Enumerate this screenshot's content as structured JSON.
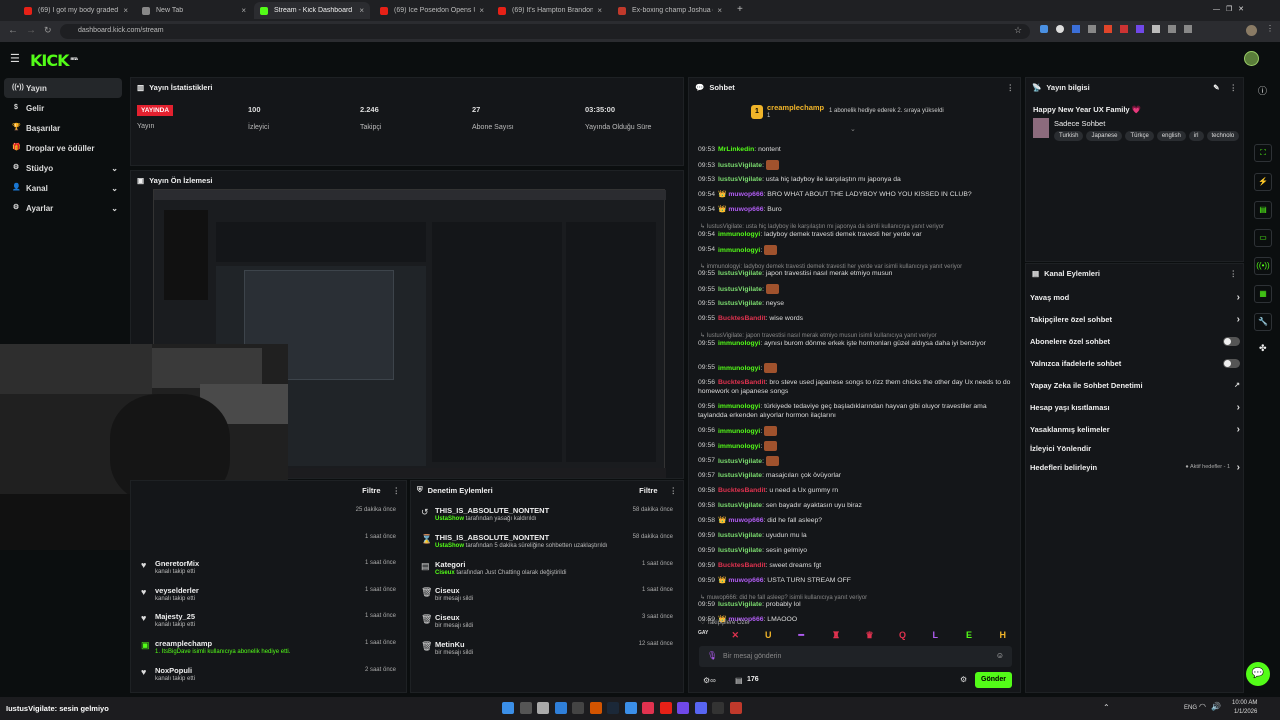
{
  "browser": {
    "tabs": [
      {
        "label": "(69) I got my body graded in J…",
        "color": "#e62117"
      },
      {
        "label": "New Tab",
        "color": "#888888"
      },
      {
        "label": "Stream - Kick Dashboard",
        "color": "#53fc18"
      },
      {
        "label": "(69) Ice Poseidon Opens Up o…",
        "color": "#e62117"
      },
      {
        "label": "(69) It's Hampton Brandon in J…",
        "color": "#e62117"
      },
      {
        "label": "Ex-boxing champ Joshua ditch…",
        "color": "#c0392b"
      }
    ],
    "url": "dashboard.kick.com/stream"
  },
  "site": {
    "logo": "KICK",
    "logo_badge": "BETA"
  },
  "sidenav": [
    {
      "label": "Yayın",
      "icon": "broadcast-icon"
    },
    {
      "label": "Gelir",
      "icon": "dollar-icon"
    },
    {
      "label": "Başarılar",
      "icon": "trophy-icon"
    },
    {
      "label": "Droplar ve ödüller",
      "icon": "gift-icon"
    },
    {
      "label": "Stüdyo",
      "icon": "gear-icon",
      "chev": "⌄"
    },
    {
      "label": "Kanal",
      "icon": "user-icon",
      "chev": "⌄"
    },
    {
      "label": "Ayarlar",
      "icon": "settings-icon",
      "chev": "⌄"
    }
  ],
  "stats": {
    "title": "Yayın İstatistikleri",
    "live_badge": "YAYINDA",
    "live_label": "Yayın",
    "items": [
      {
        "value": "100",
        "label": "İzleyici"
      },
      {
        "value": "2.246",
        "label": "Takipçi"
      },
      {
        "value": "27",
        "label": "Abone Sayısı"
      },
      {
        "value": "03:35:00",
        "label": "Yayında Olduğu Süre"
      }
    ]
  },
  "preview": {
    "title": "Yayın Ön İzlemesi"
  },
  "activity": {
    "filter": "Filtre",
    "events": [
      {
        "name": "",
        "desc": "",
        "time": "25 dakika önce"
      },
      {
        "name": "",
        "desc": "",
        "time": "1 saat önce"
      },
      {
        "name": "GneretorMix",
        "desc": "kanalı takip etti",
        "time": "1 saat önce"
      },
      {
        "name": "veyselderler",
        "desc": "kanalı takip etti",
        "time": "1 saat önce"
      },
      {
        "name": "Majesty_25",
        "desc": "kanalı takip etti",
        "time": "1 saat önce"
      },
      {
        "name": "creamplechamp",
        "desc": "1. ItsBigDave isimli kullanıcıya abonelik hediye etti.",
        "time": "1 saat önce"
      },
      {
        "name": "NoxPopuli",
        "desc": "kanalı takip etti",
        "time": "2 saat önce"
      }
    ]
  },
  "mod": {
    "title": "Denetim Eylemleri",
    "filter": "Filtre",
    "events": [
      {
        "name": "THIS_IS_ABSOLUTE_NONTENT",
        "actor": "UstaShow",
        "desc": " tarafından yasağı kaldırıldı",
        "time": "58 dakika önce",
        "icon": "undo-icon"
      },
      {
        "name": "THIS_IS_ABSOLUTE_NONTENT",
        "actor": "UstaShow",
        "desc": " tarafından 5 dakika süreliğine sohbetten uzaklaştırıldı",
        "time": "58 dakika önce",
        "icon": "hourglass-icon"
      },
      {
        "name": "Kategori",
        "actor": "Ciseux",
        "desc": " tarafından Just Chatting olarak değiştirildi",
        "time": "1 saat önce",
        "icon": "category-icon"
      },
      {
        "name": "Ciseux",
        "actor": "",
        "desc": "bir mesajı sildi",
        "time": "1 saat önce",
        "icon": "trash-icon"
      },
      {
        "name": "Ciseux",
        "actor": "",
        "desc": "bir mesajı sildi",
        "time": "3 saat önce",
        "icon": "trash-icon"
      },
      {
        "name": "MetinKu",
        "actor": "",
        "desc": "bir mesajı sildi",
        "time": "12 saat önce",
        "icon": "trash-icon"
      }
    ]
  },
  "chat": {
    "title": "Sohbet",
    "pinned_user": "creamplechamp",
    "pinned_count": "1",
    "pinned_text": "1 abonelik hediye ederek 2. sıraya yükseldi",
    "messages": [
      {
        "ts": "09:53",
        "user": "MrLinkedin",
        "color": "#53fc18",
        "text": "nontent"
      },
      {
        "ts": "09:53",
        "user": "IustusVigilate",
        "color": "#7bdc6f",
        "text": "",
        "emote": true
      },
      {
        "ts": "09:53",
        "user": "IustusVigilate",
        "color": "#7bdc6f",
        "text": "usta hiç ladyboy ile karşılaştın mı japonya da"
      },
      {
        "ts": "09:54",
        "user": "muwop666",
        "color": "#b05cf2",
        "text": "BRO WHAT ABOUT THE LADYBOY WHO YOU KISSED IN CLUB?"
      },
      {
        "ts": "09:54",
        "user": "muwop666",
        "color": "#b05cf2",
        "text": "Buro"
      },
      {
        "reply": "IustusVigilate: usta hiç ladyboy ile karşılaştın mı japonya da isimli kullanıcıya yanıt veriyor"
      },
      {
        "ts": "09:54",
        "user": "immunologyi",
        "color": "#53fc18",
        "text": "ladyboy demek travesti demek travesti her yerde var"
      },
      {
        "ts": "09:54",
        "user": "immunologyi",
        "color": "#53fc18",
        "text": "",
        "emote": true
      },
      {
        "reply": "immunologyi: ladyboy demek travesti demek travesti her yerde var isimli kullanıcıya yanıt veriyor"
      },
      {
        "ts": "09:55",
        "user": "IustusVigilate",
        "color": "#7bdc6f",
        "text": "japon travestisi nasıl merak etmiyo musun"
      },
      {
        "ts": "09:55",
        "user": "IustusVigilate",
        "color": "#7bdc6f",
        "text": "",
        "emote": true
      },
      {
        "ts": "09:55",
        "user": "IustusVigilate",
        "color": "#7bdc6f",
        "text": "neyse"
      },
      {
        "ts": "09:55",
        "user": "BucktesBandit",
        "color": "#e0324f",
        "text": "wise words"
      },
      {
        "reply": "IustusVigilate: japon travestisi nasıl merak etmiyo musun isimli kullanıcıya yanıt veriyor"
      },
      {
        "ts": "09:55",
        "user": "immunologyi",
        "color": "#53fc18",
        "text": "aynısı burom dönme erkek işte hormonları güzel aldıysa daha iyi benziyor"
      },
      {
        "ts": "09:55",
        "user": "immunologyi",
        "color": "#53fc18",
        "text": "",
        "emote": true
      },
      {
        "ts": "09:56",
        "user": "BucktesBandit",
        "color": "#e0324f",
        "text": "bro steve used japanese songs to rizz them chicks the other day Ux needs to do homework on japanese songs"
      },
      {
        "ts": "09:56",
        "user": "immunologyi",
        "color": "#53fc18",
        "text": "türkiyede tedaviye geç başladıklarından hayvan gibi oluyor travestiler ama taylandda erkenden alıyorlar hormon ilaçlarını"
      },
      {
        "ts": "09:56",
        "user": "immunologyi",
        "color": "#53fc18",
        "text": "",
        "emote": true
      },
      {
        "ts": "09:56",
        "user": "immunologyi",
        "color": "#53fc18",
        "text": "",
        "emote": true
      },
      {
        "ts": "09:57",
        "user": "IustusVigilate",
        "color": "#7bdc6f",
        "text": "",
        "emote": true
      },
      {
        "ts": "09:57",
        "user": "IustusVigilate",
        "color": "#7bdc6f",
        "text": "masajcıları çok övüyorlar"
      },
      {
        "ts": "09:58",
        "user": "BucktesBandit",
        "color": "#e0324f",
        "text": "u need a Ux gummy rn"
      },
      {
        "ts": "09:58",
        "user": "IustusVigilate",
        "color": "#7bdc6f",
        "text": "sen bayadır ayaktasın uyu biraz"
      },
      {
        "ts": "09:58",
        "user": "muwop666",
        "color": "#b05cf2",
        "text": "did he fall asleep?"
      },
      {
        "ts": "09:59",
        "user": "IustusVigilate",
        "color": "#7bdc6f",
        "text": "uyudun mu la"
      },
      {
        "ts": "09:59",
        "user": "IustusVigilate",
        "color": "#7bdc6f",
        "text": "sesin gelmiyo"
      },
      {
        "ts": "09:59",
        "user": "BucktesBandit",
        "color": "#e0324f",
        "text": "sweet dreams fgt"
      },
      {
        "ts": "09:59",
        "user": "muwop666",
        "color": "#b05cf2",
        "text": "USTA TURN STREAM OFF"
      },
      {
        "reply": "muwop666: did he fall asleep? isimli kullanıcıya yanıt veriyor"
      },
      {
        "ts": "09:59",
        "user": "IustusVigilate",
        "color": "#7bdc6f",
        "text": "probably lol"
      },
      {
        "ts": "09:59",
        "user": "muwop666",
        "color": "#b05cf2",
        "text": "LMAOOO"
      }
    ],
    "followers_only": "Takipçilere Özel",
    "emotes": [
      "GAY",
      "✕",
      "U",
      "━",
      "♜",
      "♛",
      "Q",
      "L",
      "E",
      "H"
    ],
    "input_placeholder": "Bir mesaj gönderin",
    "viewer_count": "176",
    "send": "Gönder"
  },
  "stream_info": {
    "title": "Yayın bilgisi",
    "stream_title": "Happy New Year UX Family 💗",
    "category": "Sadece Sohbet",
    "tags": [
      "Turkish",
      "Japanese",
      "Türkçe",
      "english",
      "irl",
      "technolo"
    ]
  },
  "channel_actions": {
    "title": "Kanal Eylemleri",
    "items": [
      {
        "label": "Yavaş mod",
        "kind": "chev"
      },
      {
        "label": "Takipçilere özel sohbet",
        "kind": "chev"
      },
      {
        "label": "Abonelere özel sohbet",
        "kind": "toggle"
      },
      {
        "label": "Yalnızca ifadelerle sohbet",
        "kind": "toggle"
      },
      {
        "label": "Yapay Zeka ile Sohbet Denetimi",
        "kind": "ext"
      },
      {
        "label": "Hesap yaşı kısıtlaması",
        "kind": "chev"
      },
      {
        "label": "Yasaklanmış kelimeler",
        "kind": "chev"
      },
      {
        "label": "İzleyici Yönlendir",
        "kind": "none"
      },
      {
        "label": "Hedefleri belirleyin",
        "kind": "chev",
        "extra": "Aktif hedefler - 1"
      }
    ]
  },
  "overlay_caption": "IustusVigilate: sesin gelmiyo",
  "taskbar": {
    "lang": "ENG",
    "time": "10:00 AM",
    "date": "1/1/2026"
  }
}
